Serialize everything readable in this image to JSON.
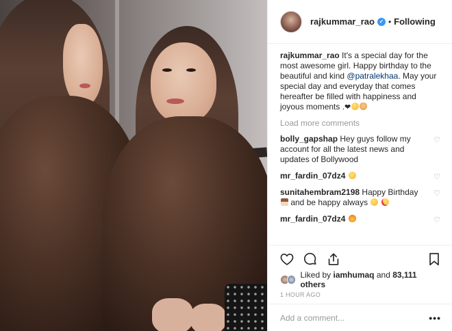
{
  "post": {
    "author": {
      "username": "rajkummar_rao",
      "verified_icon": "verified-badge-icon",
      "separator": "•",
      "follow_status": "Following"
    },
    "caption": {
      "username": "rajkummar_rao",
      "text_before_mention": " It's a special day for the most awesome girl. Happy birthday to the beautiful and kind ",
      "mention": "@patralekhaa",
      "text_after_mention": ". May your special day and everyday that comes hereafter be filled with happiness and joyous moments .",
      "emojis": [
        "black-heart",
        "blush-face",
        "hugging-face"
      ]
    },
    "load_more": "Load more comments",
    "comments": [
      {
        "username": "bolly_gapshap",
        "text": " Hey guys follow my account for all the latest news and updates of Bollywood",
        "emojis": []
      },
      {
        "username": "mr_fardin_07dz4",
        "text": " ",
        "emojis": [
          "raised-hands-face"
        ]
      },
      {
        "username": "sunitahembram2198",
        "text": " Happy Birthday ",
        "text2": " and be happy always ",
        "emojis": [
          "cake",
          "smile-face",
          "heart-eyes-face"
        ]
      },
      {
        "username": "mr_fardin_07dz4",
        "text": " ",
        "emojis": [
          "fire"
        ]
      }
    ],
    "actions": [
      "heart-icon",
      "comment-icon",
      "share-icon",
      "bookmark-icon"
    ],
    "likes": {
      "prefix": "Liked by ",
      "liker": "iamhumaq",
      "middle": " and ",
      "count": "83,111 others"
    },
    "timestamp": "1 HOUR AGO",
    "comment_placeholder": "Add a comment...",
    "more_label": "•••"
  },
  "colors": {
    "verified": "#3897f0",
    "mention": "#003569",
    "muted": "#999999",
    "text": "#262626",
    "border": "#efefef"
  }
}
